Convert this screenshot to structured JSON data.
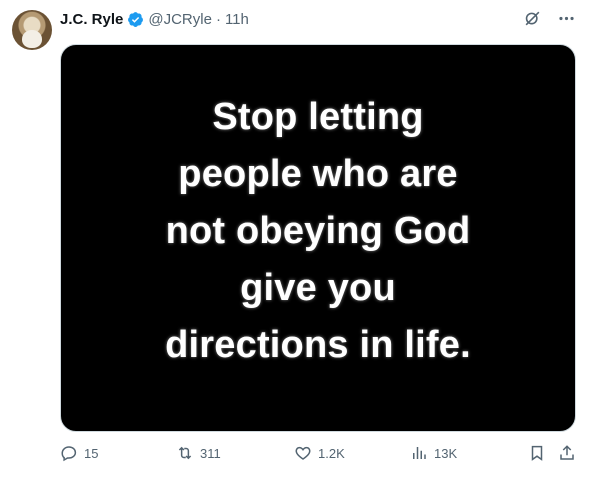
{
  "author": {
    "name": "J.C. Ryle",
    "handle": "@JCRyle",
    "separator": "·",
    "time": "11h"
  },
  "media": {
    "text": "Stop letting\npeople who are\nnot obeying God\ngive you\ndirections in life."
  },
  "metrics": {
    "replies": "15",
    "reposts": "311",
    "likes": "1.2K",
    "views": "13K"
  },
  "colors": {
    "verified": "#1d9bf0",
    "muted": "#536471",
    "media_bg": "#000000"
  }
}
